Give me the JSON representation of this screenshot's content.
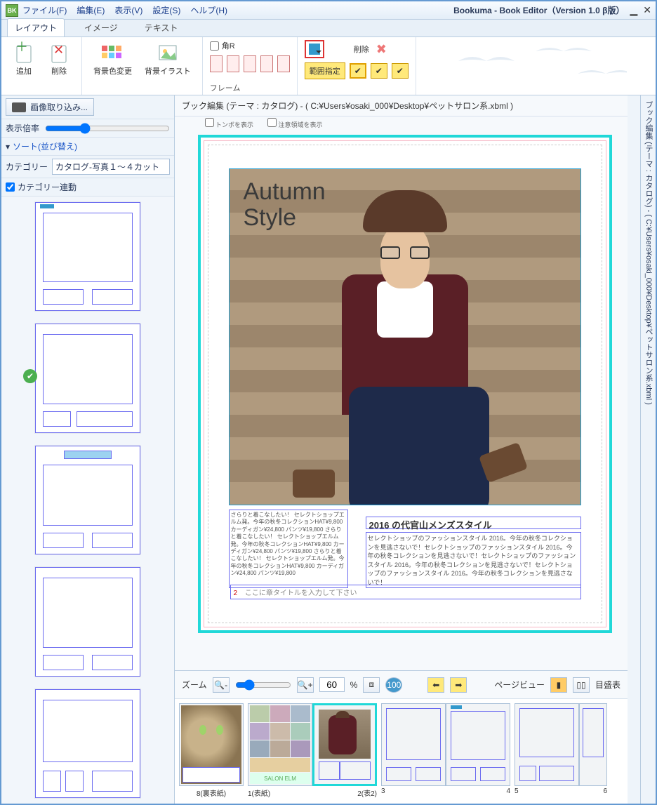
{
  "app": {
    "title": "Bookuma - Book Editor（Version 1.0 β版）"
  },
  "menu": {
    "file": "ファイル(F)",
    "edit": "編集(E)",
    "view": "表示(V)",
    "settings": "設定(S)",
    "help": "ヘルプ(H)"
  },
  "tabs": {
    "layout": "レイアウト",
    "image": "イメージ",
    "text": "テキスト"
  },
  "ribbon": {
    "add": "追加",
    "delete": "削除",
    "bgcolor": "背景色変更",
    "bgillust": "背景イラスト",
    "corner": "角R",
    "frame": "フレーム",
    "delete2": "削除",
    "range_select": "範囲指定"
  },
  "left": {
    "image_import": "画像取り込み...",
    "zoom_label": "表示倍率",
    "sort": "ソート(並び替え)",
    "category": "カテゴリー",
    "category_value": "カタログ-写真１～４カット",
    "category_sync": "カテゴリー連動"
  },
  "doc": {
    "path": "ブック編集 (テーマ : カタログ) - ( C:¥Users¥osaki_000¥Desktop¥ペットサロン系.xbml )",
    "cb_tombo": "トンボを表示",
    "cb_caution": "注意領域を表示"
  },
  "page": {
    "photo_title_1": "Autumn",
    "photo_title_2": "Style",
    "side_text": "さらりと着こなしたい！ セレクトショップエルム発。今年の秋冬コレクションHAT¥9,800 カーディガン¥24,800 パンツ¥19,800 さらりと着こなしたい！ セレクトショップエルム発。今年の秋冬コレクションHAT¥9,800 カーディガン¥24,800 パンツ¥19,800 さらりと着こなしたい！ セレクトショップエルム発。今年の秋冬コレクションHAT¥9,800 カーディガン¥24,800 パンツ¥19,800",
    "headline": "2016 の代官山メンズスタイル",
    "body": "セレクトショップのファッションスタイル 2016。今年の秋冬コレクションを見逃さないで！セレクトショップのファッションスタイル 2016。今年の秋冬コレクションを見逃さないで！セレクトショップのファッションスタイル 2016。今年の秋冬コレクションを見逃さないで！セレクトショップのファッションスタイル 2016。今年の秋冬コレクションを見逃さないで！",
    "page_no": "2",
    "page_title_hint": "ここに章タイトルを入力して下さい"
  },
  "rightdock": "ブック編集 (テーマ : カタログ) - ( C:¥Users¥osaki_000¥Desktop¥ペットサロン系.xbml )",
  "bottom": {
    "zoom": "ズーム",
    "zoom_value": "60",
    "percent": "%",
    "pageview": "ページビュー",
    "scale": "目盛表"
  },
  "filmstrip": {
    "p8": "8(裏表紙)",
    "p1": "1(表紙)",
    "p2": "2(表2)",
    "p3": "3",
    "p4": "4",
    "p5": "5",
    "p6": "6",
    "salon": "SALON ELM"
  }
}
